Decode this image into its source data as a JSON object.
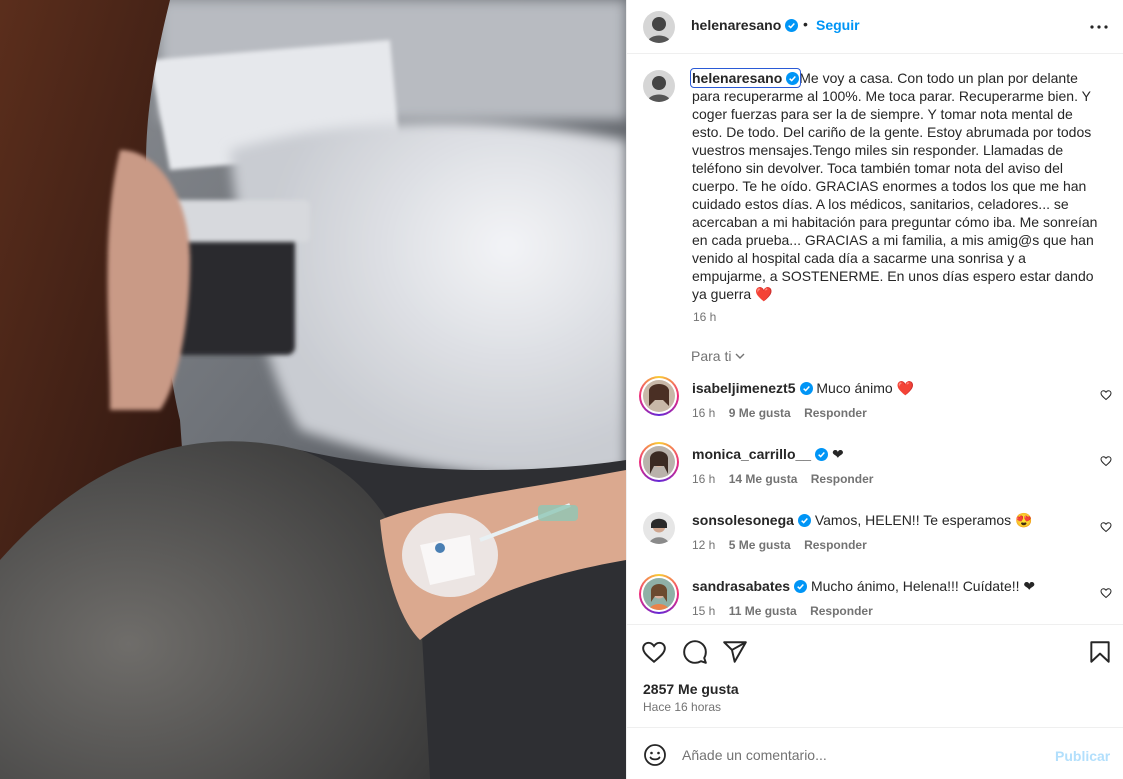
{
  "post": {
    "username": "helenaresano",
    "follow_label": "Seguir",
    "separator": "•",
    "caption": "Me voy a casa. Con todo un plan por delante para recuperarme al 100%. Me toca parar. Recuperarme bien. Y coger fuerzas para ser la de siempre. Y tomar nota mental de esto. De todo. Del cariño de la gente. Estoy abrumada por todos vuestros mensajes.Tengo miles sin responder. Llamadas de teléfono sin devolver. Toca también tomar nota del aviso del cuerpo. Te he oído. GRACIAS enormes a todos los que me han cuidado estos días. A los médicos, sanitarios, celadores... se acercaban a mi habitación para preguntar cómo iba. Me sonreían en cada prueba... GRACIAS a mi familia, a mis amig@s que han venido al hospital cada día a sacarme una sonrisa y a empujarme, a SOSTENERME. En unos días espero estar dando ya guerra ❤️",
    "time": "16 h",
    "likes": "2857 Me gusta",
    "ago": "Hace 16 horas"
  },
  "filter_label": "Para ti",
  "comments": [
    {
      "user": "isabeljimenezt5",
      "text": "Muco ánimo ❤️",
      "time": "16 h",
      "likes": "9 Me gusta",
      "reply": "Responder",
      "ring": true
    },
    {
      "user": "monica_carrillo__",
      "text": "❤",
      "time": "16 h",
      "likes": "14 Me gusta",
      "reply": "Responder",
      "ring": true
    },
    {
      "user": "sonsolesonega",
      "text": "Vamos, HELEN!! Te esperamos 😍",
      "time": "12 h",
      "likes": "5 Me gusta",
      "reply": "Responder",
      "ring": false
    },
    {
      "user": "sandrasabates",
      "text": "Mucho ánimo, Helena!!! Cuídate!! ❤",
      "time": "15 h",
      "likes": "11 Me gusta",
      "reply": "Responder",
      "ring": true
    }
  ],
  "composer": {
    "placeholder": "Añade un comentario...",
    "post_label": "Publicar"
  },
  "icons": {
    "verified": "verified-badge-icon",
    "more": "more-options-icon",
    "like": "heart-icon",
    "comment": "comment-bubble-icon",
    "share": "send-icon",
    "save": "bookmark-icon",
    "emoji": "emoji-icon",
    "chevron": "chevron-down-icon"
  },
  "colors": {
    "link_blue": "#0095f6",
    "verified_blue": "#0095f6",
    "muted": "#737373",
    "disabled_blue": "#b2dffc"
  }
}
